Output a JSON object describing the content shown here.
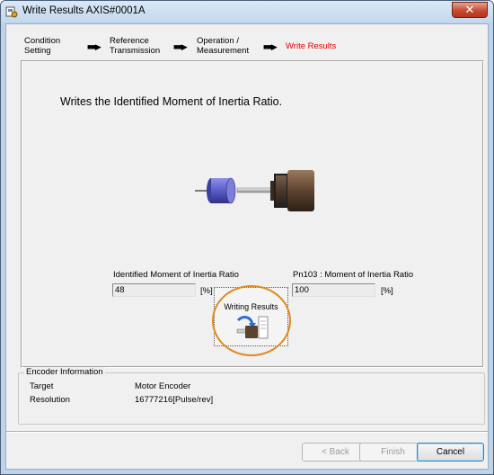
{
  "window": {
    "title": "Write Results AXIS#0001A",
    "close_glyph": "✕"
  },
  "steps": [
    {
      "label": "Condition\nSetting",
      "active": false
    },
    {
      "label": "Reference\nTransmission",
      "active": false
    },
    {
      "label": "Operation /\nMeasurement",
      "active": false
    },
    {
      "label": "Write Results",
      "active": true
    }
  ],
  "step_arrow": "■■▶",
  "main": {
    "headline": "Writes the Identified Moment of Inertia Ratio.",
    "identified": {
      "label": "Identified Moment of Inertia Ratio",
      "value": "48",
      "unit": "[%]"
    },
    "parameter": {
      "label": "Pn103   : Moment of Inertia Ratio",
      "value": "100",
      "unit": "[%]"
    },
    "write_button_label": "Writing Results"
  },
  "encoder": {
    "title": "Encoder Information",
    "target_label": "Target",
    "target_value": "Motor Encoder",
    "resolution_label": "Resolution",
    "resolution_value": "16777216[Pulse/rev]"
  },
  "buttons": {
    "back": "< Back",
    "finish": "Finish",
    "cancel": "Cancel"
  },
  "colors": {
    "active_step": "#e00000",
    "highlight_ring": "#e08a1c",
    "client_bg": "#f0f0f0"
  },
  "icons": [
    "app-icon",
    "close-icon",
    "step-arrow-icon",
    "motor-icon",
    "play-arrow-icon",
    "write-to-motor-icon"
  ]
}
